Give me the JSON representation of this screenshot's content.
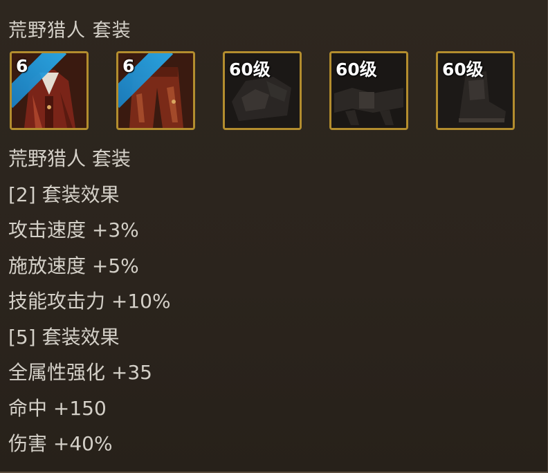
{
  "header": {
    "set_name": "荒野猎人 套装"
  },
  "items": [
    {
      "level": "6",
      "owned": true,
      "icon": "armor-top-icon"
    },
    {
      "level": "6",
      "owned": true,
      "icon": "armor-pants-icon"
    },
    {
      "level": "60级",
      "owned": false,
      "icon": "armor-shoulder-icon"
    },
    {
      "level": "60级",
      "owned": false,
      "icon": "armor-belt-icon"
    },
    {
      "level": "60级",
      "owned": false,
      "icon": "armor-boots-icon"
    }
  ],
  "tooltip": {
    "set_name": "荒野猎人 套装",
    "bonus2_header": "[2] 套装效果",
    "bonus2_lines": [
      "攻击速度 +3%",
      "施放速度 +5%",
      "技能攻击力 +10%"
    ],
    "bonus5_header": "[5] 套装效果",
    "bonus5_lines": [
      "全属性强化 +35",
      "命中 +150",
      "伤害 +40%"
    ]
  },
  "colors": {
    "gold_border": "#b38d2e",
    "text": "#d4d0c8",
    "ribbon_blue": "#29a9e8",
    "owned_bg": "#3a1a10"
  }
}
